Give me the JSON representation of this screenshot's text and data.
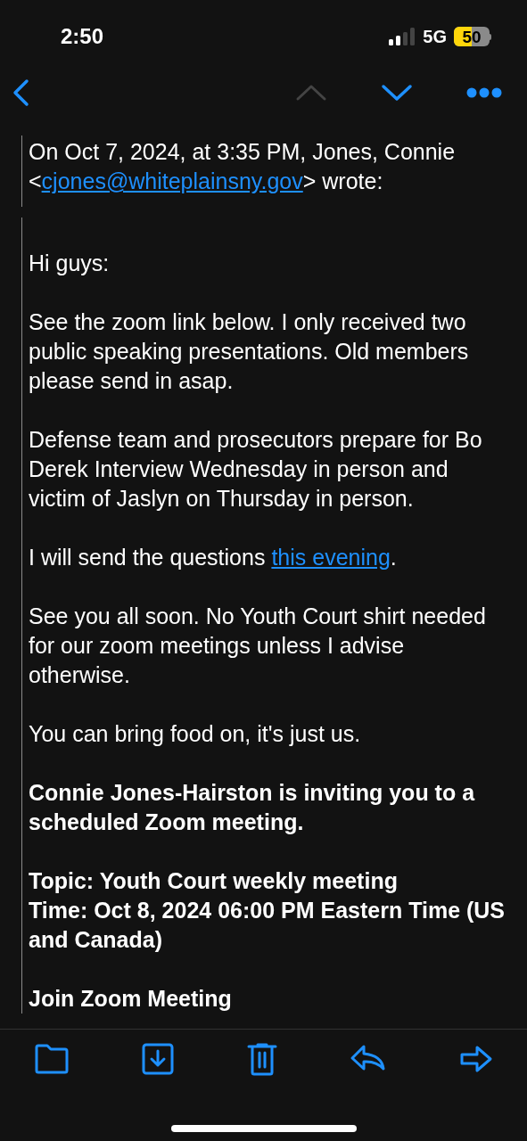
{
  "status_bar": {
    "time": "2:50",
    "network": "5G",
    "battery": "50"
  },
  "header": [
    {
      "text": "On Oct 7, 2024, at 3:35 PM, Jones, Connie <",
      "link": false
    },
    {
      "text": "cjones@whiteplainsny.gov",
      "link": true
    },
    {
      "text": "> wrote:",
      "link": false
    }
  ],
  "paragraphs": [
    {
      "kind": "text",
      "parts": [
        {
          "text": "Hi guys:",
          "link": false
        }
      ]
    },
    {
      "kind": "text",
      "parts": [
        {
          "text": "See the zoom link below. I only received two public speaking presentations. Old members please send in asap.",
          "link": false
        }
      ]
    },
    {
      "kind": "text",
      "parts": [
        {
          "text": "Defense team and prosecutors prepare for Bo Derek Interview Wednesday in person and victim of Jaslyn on Thursday in person.",
          "link": false
        }
      ]
    },
    {
      "kind": "text",
      "parts": [
        {
          "text": "I will send the questions ",
          "link": false
        },
        {
          "text": "this evening",
          "link": true
        },
        {
          "text": ".",
          "link": false
        }
      ]
    },
    {
      "kind": "text",
      "parts": [
        {
          "text": "See you all soon. No Youth Court shirt needed for our zoom meetings unless I advise otherwise.",
          "link": false
        }
      ]
    },
    {
      "kind": "text",
      "parts": [
        {
          "text": "You can bring food on, it's just us.",
          "link": false
        }
      ]
    },
    {
      "kind": "bold",
      "parts": [
        {
          "text": "Connie Jones-Hairston is inviting you to a scheduled Zoom meeting.",
          "link": false
        }
      ]
    },
    {
      "kind": "bold",
      "parts": [
        {
          "text": "Topic: Youth Court weekly meeting",
          "link": false
        }
      ]
    },
    {
      "kind": "bold",
      "tight": true,
      "parts": [
        {
          "text": "Time: Oct 8, 2024 06:00 PM Eastern Time (US and Canada)",
          "link": false
        }
      ]
    },
    {
      "kind": "bold",
      "parts": [
        {
          "text": "Join Zoom Meeting",
          "link": false
        }
      ]
    }
  ]
}
